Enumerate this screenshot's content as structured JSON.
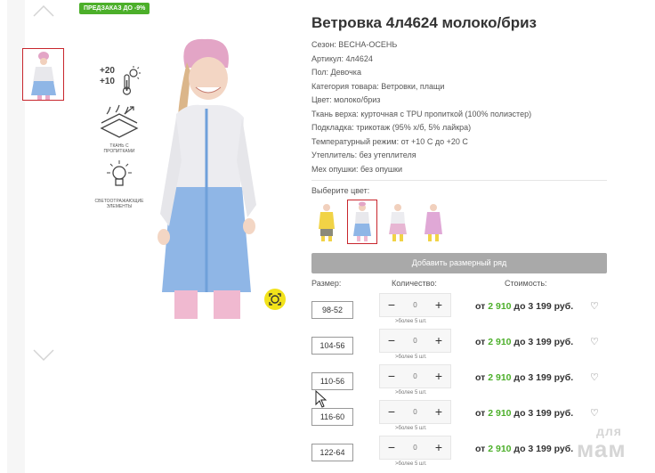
{
  "badge": "ПРЕДЗАКАЗ ДО -9%",
  "product": {
    "title": "Ветровка 4л4624 молоко/бриз",
    "specs": [
      "Сезон: ВЕСНА-ОСЕНЬ",
      "Артикул: 4л4624",
      "Пол: Девочка",
      "Категория товара: Ветровки, плащи",
      "Цвет: молоко/бриз",
      "Ткань верха: курточная с TPU пропиткой (100% полиэстер)",
      "Подкладка: трикотаж (95% х/б, 5% лайкра)",
      "Температурный режим: от +10 С до +20 С",
      "Утеплитель: без утеплителя",
      "Мех опушки: без опушки"
    ]
  },
  "features": {
    "temp_high": "+20",
    "temp_low": "+10",
    "fabric_caption": "ТКАНЬ С ПРОПИТКАМИ",
    "reflect_caption": "СВЕТООТРАЖАЮЩИЕ ЭЛЕМЕНТЫ"
  },
  "color_select": {
    "label": "Выберите цвет:",
    "selected_index": 1,
    "swatch_icons": [
      "girl-yellow-jacket",
      "girl-white-blue-jacket",
      "girl-white-pink-jacket",
      "girl-pink-jacket"
    ]
  },
  "add_row_button": "Добавить размерный ряд",
  "table": {
    "headers": {
      "size": "Размер:",
      "qty": "Количество:",
      "cost": "Стоимость:"
    },
    "rows": [
      {
        "size": "98-52",
        "qty": "0",
        "note": ">более 5 шт.",
        "price_from": "от ",
        "price_low": "2 910",
        "price_to": " до 3 199 руб."
      },
      {
        "size": "104-56",
        "qty": "0",
        "note": ">более 5 шт.",
        "price_from": "от ",
        "price_low": "2 910",
        "price_to": " до 3 199 руб."
      },
      {
        "size": "110-56",
        "qty": "0",
        "note": ">более 5 шт.",
        "price_from": "от ",
        "price_low": "2 910",
        "price_to": " до 3 199 руб."
      },
      {
        "size": "116-60",
        "qty": "0",
        "note": ">более 5 шт.",
        "price_from": "от ",
        "price_low": "2 910",
        "price_to": " до 3 199 руб."
      },
      {
        "size": "122-64",
        "qty": "0",
        "note": ">более 5 шт.",
        "price_from": "от ",
        "price_low": "2 910",
        "price_to": " до 3 199 руб."
      }
    ],
    "minus": "−",
    "plus": "+",
    "heart": "♡"
  },
  "watermark": {
    "line1": "для",
    "line2": "мам"
  },
  "colors": {
    "accent_green": "#4caf2a",
    "selected_border": "#c8262d",
    "zoom_yellow": "#f2e21a"
  }
}
